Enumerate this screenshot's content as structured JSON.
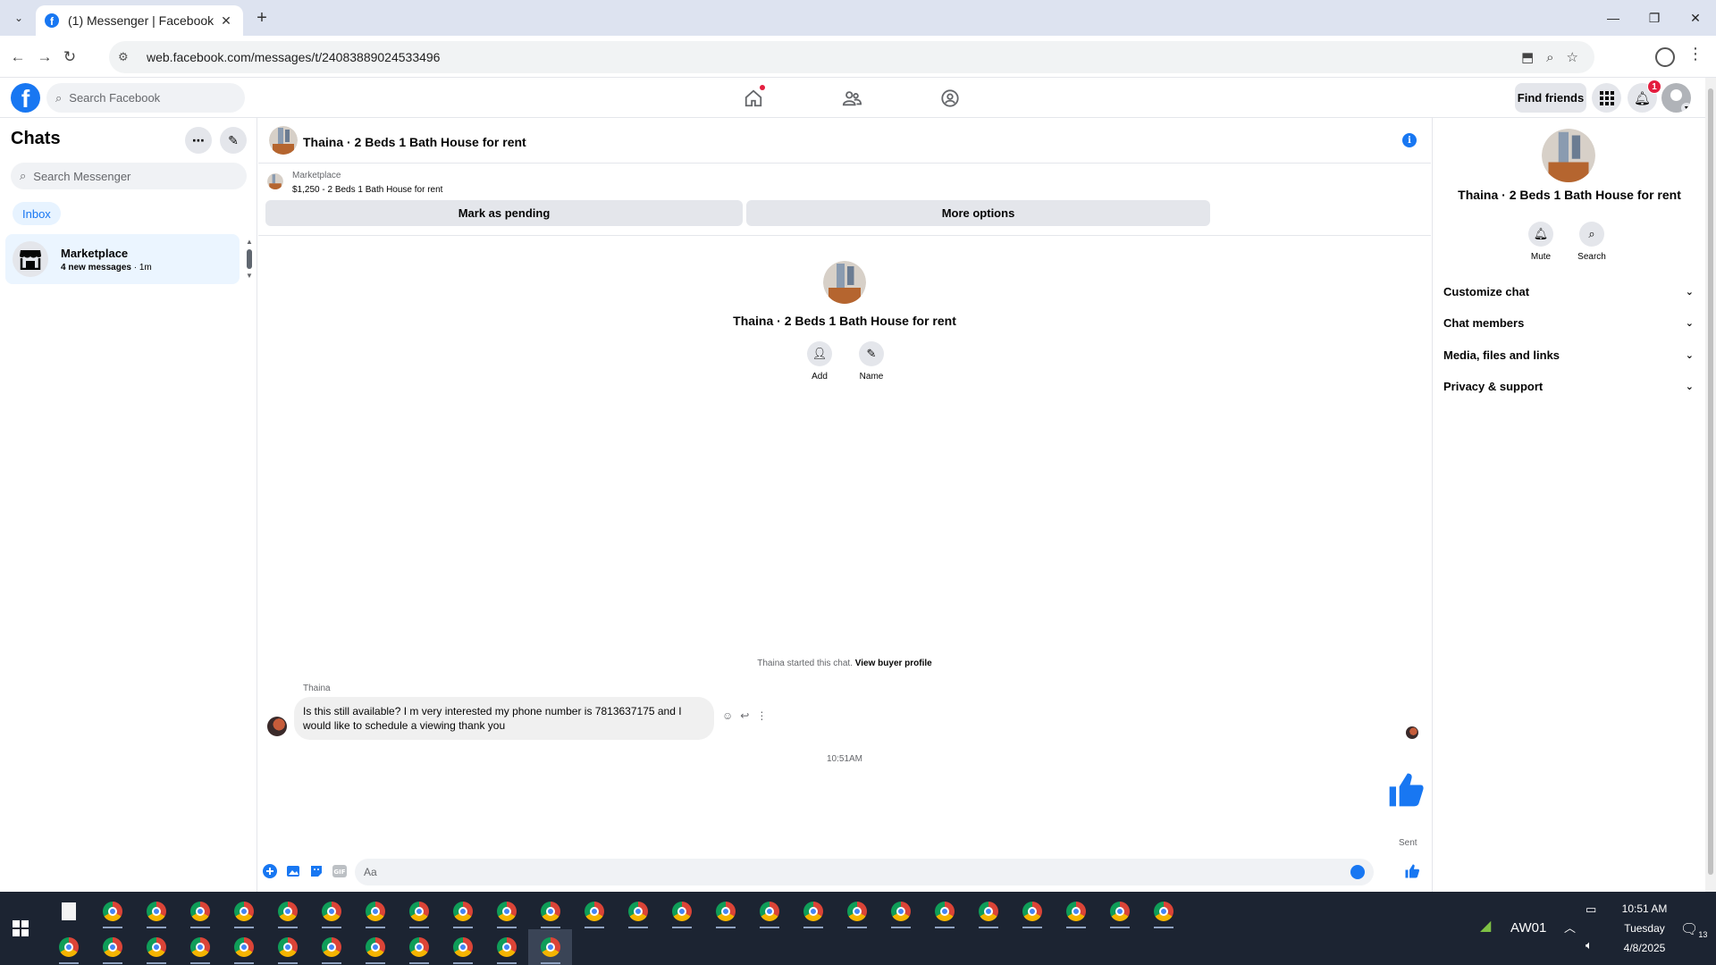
{
  "browser": {
    "tab_title": "(1) Messenger | Facebook",
    "url": "web.facebook.com/messages/t/24083889024533496"
  },
  "fb_nav": {
    "search_placeholder": "Search Facebook",
    "find_friends": "Find friends",
    "notification_count": "1"
  },
  "sidebar": {
    "title": "Chats",
    "search_placeholder": "Search Messenger",
    "filter": "Inbox",
    "chats": [
      {
        "name": "Marketplace",
        "unread": "4 new messages",
        "time": " · 1m"
      }
    ]
  },
  "conversation": {
    "title": "Thaina · 2 Beds 1 Bath House for rent",
    "listing_label": "Marketplace",
    "listing_price": "$1,250 - 2 Beds 1 Bath House for rent",
    "mark_pending": "Mark as pending",
    "more_options": "More options",
    "intro_name": "Thaina · 2 Beds 1 Bath House for rent",
    "intro_add": "Add",
    "intro_name_action": "Name",
    "started_text": "Thaina started this chat. ",
    "view_buyer_profile": "View buyer profile",
    "sender": "Thaina",
    "message": "Is this still available? I m very interested my phone number is 7813637175  and I would like to schedule a viewing thank you",
    "timestamp": "10:51AM",
    "sent_label": "Sent",
    "composer_placeholder": "Aa"
  },
  "details": {
    "name": "Thaina · 2 Beds 1 Bath House for rent",
    "mute": "Mute",
    "search": "Search",
    "sections": [
      "Customize chat",
      "Chat members",
      "Media, files and links",
      "Privacy & support"
    ]
  },
  "taskbar": {
    "network_label": "AW01",
    "time": "10:51 AM",
    "day": "Tuesday",
    "date": "4/8/2025",
    "notification_count": "13"
  },
  "colors": {
    "accent": "#1877f2",
    "badge": "#e41e3f",
    "taskbar": "#1c2432"
  }
}
